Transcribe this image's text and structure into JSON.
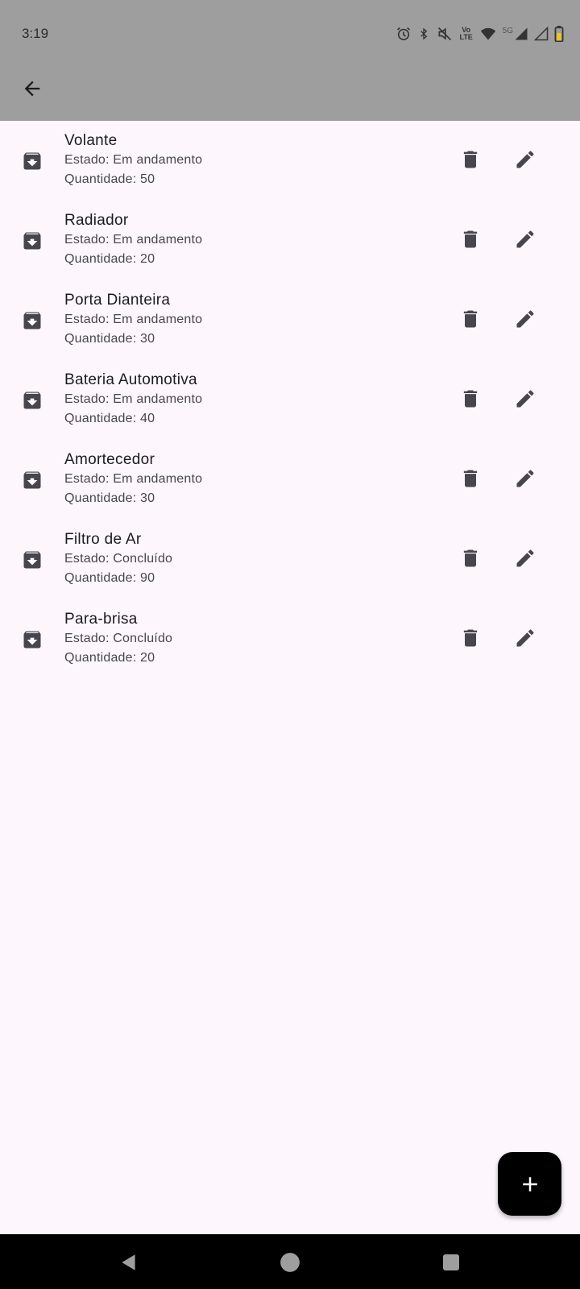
{
  "status_bar": {
    "time": "3:19",
    "icons": [
      "alarm-icon",
      "bluetooth-icon",
      "mute-icon",
      "volte-icon",
      "wifi-icon",
      "signal-5g-icon",
      "signal-icon",
      "battery-icon"
    ],
    "volte_text": "Vo LTE",
    "network_label": "5G"
  },
  "app_bar": {
    "back_icon": "arrow-back-icon"
  },
  "items": [
    {
      "title": "Volante",
      "estado": "Estado: Em andamento",
      "quantidade": "Quantidade: 50"
    },
    {
      "title": "Radiador",
      "estado": "Estado: Em andamento",
      "quantidade": "Quantidade: 20"
    },
    {
      "title": "Porta Dianteira",
      "estado": "Estado: Em andamento",
      "quantidade": "Quantidade: 30"
    },
    {
      "title": "Bateria Automotiva",
      "estado": "Estado: Em andamento",
      "quantidade": "Quantidade: 40"
    },
    {
      "title": "Amortecedor",
      "estado": "Estado: Em andamento",
      "quantidade": "Quantidade: 30"
    },
    {
      "title": "Filtro de Ar",
      "estado": "Estado: Concluído",
      "quantidade": "Quantidade: 90"
    },
    {
      "title": "Para-brisa",
      "estado": "Estado: Concluído",
      "quantidade": "Quantidade: 20"
    }
  ],
  "row_icons": {
    "leading": "archive-icon",
    "delete": "delete-icon",
    "edit": "edit-icon"
  },
  "fab": {
    "icon": "add-icon"
  },
  "nav_bar": {
    "icons": [
      "back-triangle-icon",
      "home-circle-icon",
      "recents-square-icon"
    ]
  },
  "colors": {
    "app_bar": "#9e9e9e",
    "background": "#fdf7fd",
    "icon": "#49454f",
    "fab": "#000000"
  }
}
